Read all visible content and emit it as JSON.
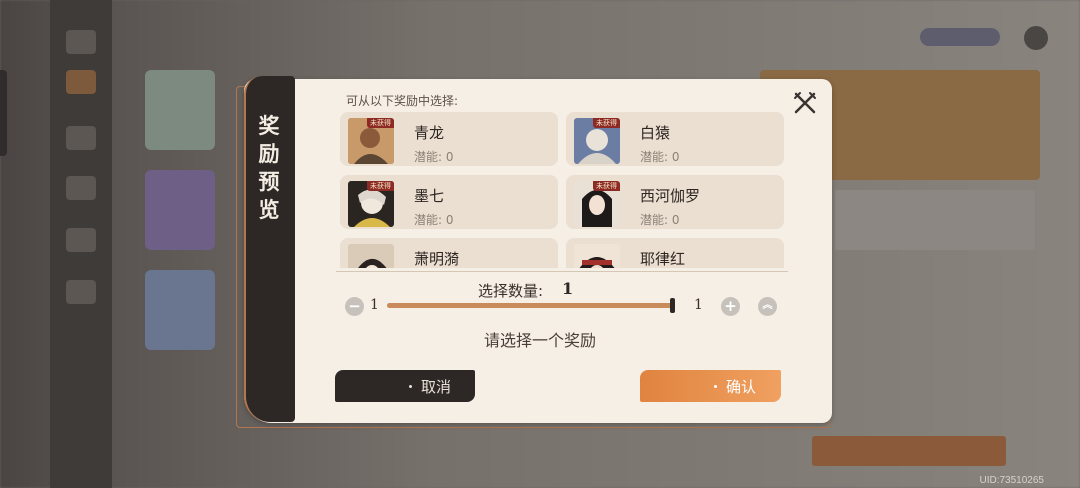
{
  "dialog": {
    "title_chars": [
      "奖",
      "励",
      "预",
      "览"
    ],
    "hint": "可从以下奖励中选择:",
    "close_icon": "close-crossed-swords-icon"
  },
  "rewards": [
    {
      "name": "青龙",
      "potential": "潜能: 0",
      "badge": "未获得",
      "avatar_color": "#b88456"
    },
    {
      "name": "白猿",
      "potential": "潜能: 0",
      "badge": "未获得",
      "avatar_color": "#6b7da3"
    },
    {
      "name": "墨七",
      "potential": "潜能: 0",
      "badge": "未获得",
      "avatar_color": "#e2d9c9"
    },
    {
      "name": "西河伽罗",
      "potential": "潜能: 0",
      "badge": "未获得",
      "avatar_color": "#3a2b2a"
    },
    {
      "name": "萧明漪",
      "potential": "",
      "badge": "",
      "avatar_color": "#c9b9a5"
    },
    {
      "name": "耶律红",
      "potential": "",
      "badge": "",
      "avatar_color": "#5a3a32"
    }
  ],
  "quantity": {
    "label": "选择数量:",
    "value": "1",
    "min": "1",
    "max": "1",
    "fill_fraction": 1.0
  },
  "prompt": "请选择一个奖励",
  "buttons": {
    "cancel": "取消",
    "confirm": "确认"
  },
  "footer": {
    "uid": "UID:73510265"
  },
  "colors": {
    "panel": "#f6efe6",
    "dark": "#2d2826",
    "accent": "#e0843f",
    "badge": "#8e2a24"
  }
}
